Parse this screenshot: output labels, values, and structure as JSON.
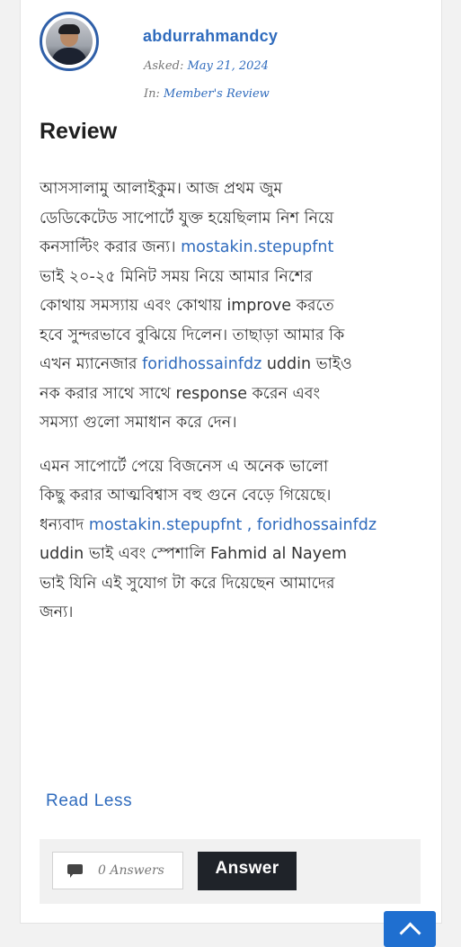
{
  "question": {
    "author": "abdurrahmandcy",
    "asked_label": "Asked:",
    "asked_date": "May 21, 2024",
    "in_label": "In:",
    "category": "Member's Review",
    "title": "Review"
  },
  "content": {
    "paragraph1": [
      [
        {
          "t": "আসসালামু আলাইকুম। আজ প্রথম জুম"
        }
      ],
      [
        {
          "t": "ডেডিকেটেড সাপোর্টে যুক্ত হয়েছিলাম নিশ নিয়ে"
        }
      ],
      [
        {
          "t": "কনসাল্টিং করার জন্য। "
        },
        {
          "t": "mostakin.stepupfnt",
          "mention": true
        }
      ],
      [
        {
          "t": "ভাই ২০-২৫ মিনিট সময় নিয়ে আমার নিশের"
        }
      ],
      [
        {
          "t": "কোথায় সমস্যায় এবং কোথায় improve করতে"
        }
      ],
      [
        {
          "t": "হবে সুন্দরভাবে বুঝিয়ে দিলেন। তাছাড়া আমার কি"
        }
      ],
      [
        {
          "t": "এখন ম্যানেজার "
        },
        {
          "t": "foridhossainfdz",
          "mention": true
        },
        {
          "t": " uddin ভাইও"
        }
      ],
      [
        {
          "t": "নক করার সাথে সাথে response করেন এবং"
        }
      ],
      [
        {
          "t": "সমস্যা গুলো সমাধান করে দেন।"
        }
      ]
    ],
    "paragraph2": [
      [
        {
          "t": "এমন সাপোর্টে পেয়ে বিজনেস এ অনেক ভালো"
        }
      ],
      [
        {
          "t": "কিছু করার আত্মবিশ্বাস বহু গুনে বেড়ে গিয়েছে।"
        }
      ],
      [
        {
          "t": "ধন্যবাদ "
        },
        {
          "t": "mostakin.stepupfnt , foridhossainfdz",
          "mention": true
        }
      ],
      [
        {
          "t": "uddin  ভাই এবং স্পেশালি Fahmid al Nayem"
        }
      ],
      [
        {
          "t": "ভাই যিনি এই সুযোগ টা করে দিয়েছেন আমাদের"
        }
      ],
      [
        {
          "t": "জন্য।"
        }
      ]
    ]
  },
  "actions": {
    "read_less": "Read Less",
    "answers_count": "0 Answers",
    "answer_button": "Answer"
  },
  "icons": {
    "answers": "comment-icon",
    "scroll_top": "chevron-up-icon"
  },
  "colors": {
    "link": "#2f6bbd",
    "button_dark": "#1f2329",
    "scroll_button": "#1f6fd0"
  }
}
